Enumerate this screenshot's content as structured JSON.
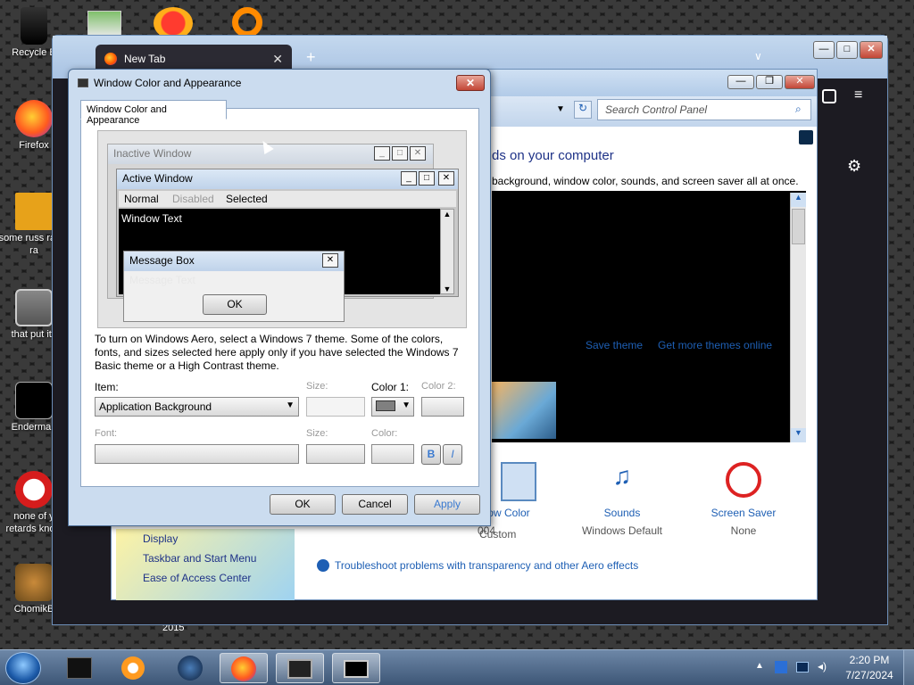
{
  "desktop": {
    "icons": [
      {
        "label": "Recycle Bin",
        "display": "Recycle B"
      },
      {
        "label": "Firefox"
      },
      {
        "label": "some russ ran a ra"
      },
      {
        "label": "that put its"
      },
      {
        "label": "Enderman"
      },
      {
        "label": "none of y retards know"
      },
      {
        "label": "ChomikBox",
        "display": "ChomikB"
      }
    ],
    "year_text": "2015"
  },
  "browser": {
    "tab_title": "New Tab",
    "new_tab": "+",
    "list_tabs": "∨",
    "minimize": "—",
    "maximize": "□",
    "close": "✕"
  },
  "control_panel": {
    "search_placeholder": "Search Control Panel",
    "headline": "ds on your computer",
    "subline": "background, window color, sounds, and screen saver all at once.",
    "save_theme": "Save theme",
    "get_more": "Get more themes online",
    "items": [
      {
        "label": "ow Color",
        "sub": "004"
      },
      {
        "label": "Sounds",
        "sub": "Windows Default"
      },
      {
        "label": "Screen Saver",
        "sub": "None"
      }
    ],
    "left_links": [
      "Display",
      "Taskbar and Start Menu",
      "Ease of Access Center"
    ],
    "troubleshoot": "Troubleshoot problems with transparency and other Aero effects",
    "custom": "Custom"
  },
  "dialog": {
    "title": "Window Color and Appearance",
    "tab": "Window Color and Appearance",
    "preview": {
      "inactive": "Inactive Window",
      "active": "Active Window",
      "menu": [
        "Normal",
        "Disabled",
        "Selected"
      ],
      "window_text": "Window Text",
      "message_box": "Message Box",
      "message_text": "Message Text",
      "ok": "OK"
    },
    "info": "To turn on Windows Aero, select a Windows 7 theme.  Some of the colors, fonts, and sizes selected here apply only if you have selected the Windows 7 Basic theme or a High Contrast theme.",
    "item_label": "Item:",
    "item_value": "Application Background",
    "size_label": "Size:",
    "color1_label": "Color 1:",
    "color2_label": "Color 2:",
    "font_label": "Font:",
    "font_size_label": "Size:",
    "font_color_label": "Color:",
    "bold": "B",
    "italic": "I",
    "ok": "OK",
    "cancel": "Cancel",
    "apply": "Apply"
  },
  "taskbar": {
    "time": "2:20 PM",
    "date": "7/27/2024"
  },
  "colors": {
    "dialog_bg": "#cbdcef",
    "taskbar": "#3d5676",
    "link": "#1e5fb4"
  }
}
